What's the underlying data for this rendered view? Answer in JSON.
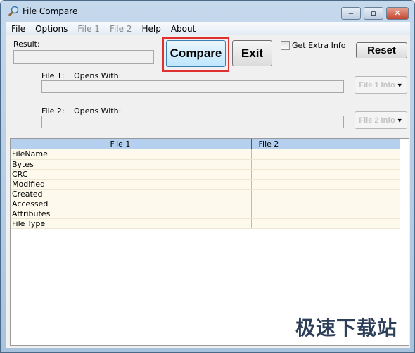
{
  "window": {
    "title": "File Compare",
    "icon": "magnifier-icon"
  },
  "menu": [
    {
      "label": "File",
      "enabled": true
    },
    {
      "label": "Options",
      "enabled": true
    },
    {
      "label": "File 1",
      "enabled": false
    },
    {
      "label": "File 2",
      "enabled": false
    },
    {
      "label": "Help",
      "enabled": true
    },
    {
      "label": "About",
      "enabled": true
    }
  ],
  "result": {
    "label": "Result:",
    "value": ""
  },
  "buttons": {
    "compare": "Compare",
    "exit": "Exit",
    "reset": "Reset",
    "file1_info": "File 1 Info",
    "file2_info": "File 2 Info"
  },
  "extra_info": {
    "label": "Get Extra Info",
    "checked": false
  },
  "file1": {
    "label": "File 1:",
    "opens_with": "Opens With:",
    "value": ""
  },
  "file2": {
    "label": "File 2:",
    "opens_with": "Opens With:",
    "value": ""
  },
  "table": {
    "columns": [
      "",
      "File 1",
      "File 2"
    ],
    "rows": [
      "FileName",
      "Bytes",
      "CRC",
      "Modified",
      "Created",
      "Accessed",
      "Attributes",
      "File Type"
    ]
  },
  "highlight_color": "#e03030",
  "watermark": "极速下载站"
}
